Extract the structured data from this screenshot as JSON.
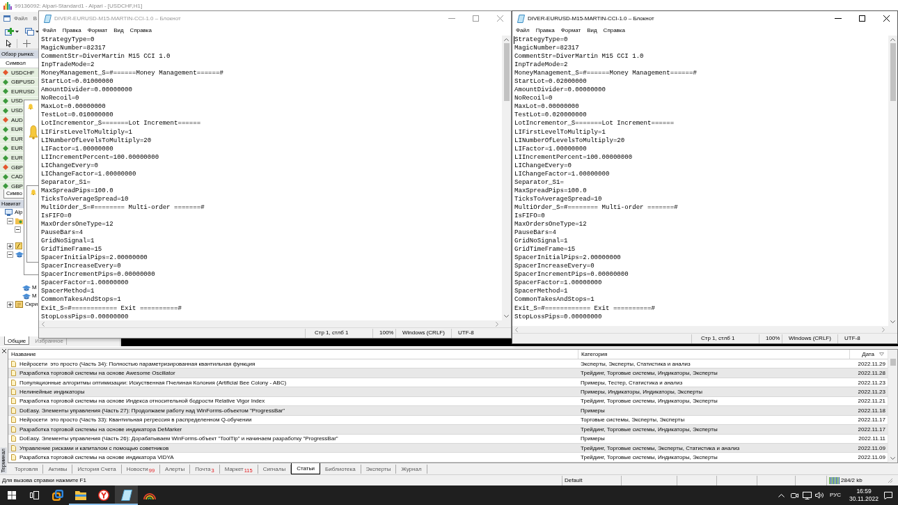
{
  "main_window": {
    "title": "99136092: Alpari-Standard1 - Alpari - [USDCHF,H1]",
    "menu": [
      "Файл",
      "В"
    ]
  },
  "market_watch": {
    "title": "Обзор рынка:",
    "column": "Символ",
    "symbols": [
      {
        "name": "USDCHF",
        "color": "#e4572e"
      },
      {
        "name": "GBPUSD",
        "color": "#3c9a3c"
      },
      {
        "name": "EURUSD",
        "color": "#3c9a3c"
      },
      {
        "name": "USD",
        "color": "#3c9a3c"
      },
      {
        "name": "USD",
        "color": "#3c9a3c"
      },
      {
        "name": "AUD",
        "color": "#e4572e"
      },
      {
        "name": "EUR",
        "color": "#3c9a3c"
      },
      {
        "name": "EUR",
        "color": "#3c9a3c"
      },
      {
        "name": "EUR",
        "color": "#3c9a3c"
      },
      {
        "name": "EUR",
        "color": "#3c9a3c"
      },
      {
        "name": "GBP",
        "color": "#e4572e"
      },
      {
        "name": "CAD",
        "color": "#3c9a3c"
      },
      {
        "name": "GBP",
        "color": "#3c9a3c"
      }
    ],
    "tab": "Симво"
  },
  "navigator": {
    "title": "Навигат",
    "tree": [
      {
        "kind": "terminal",
        "label": "Alp",
        "children": [
          {
            "kind": "accounts",
            "expanded": true,
            "children": [
              {
                "kind": "account",
                "expanded": true
              }
            ]
          },
          {
            "kind": "indicators",
            "expanded": false
          },
          {
            "kind": "experts",
            "expanded": true,
            "children": [
              {
                "kind": "expert",
                "label": "М"
              },
              {
                "kind": "expert",
                "label": "М"
              }
            ]
          },
          {
            "kind": "scripts",
            "expanded": false,
            "label": "Скри"
          }
        ]
      }
    ],
    "tabs": [
      {
        "label": "Общие",
        "selected": true
      },
      {
        "label": "Избранное",
        "selected": false
      }
    ]
  },
  "notepad_windows": [
    {
      "title": "DIVER-EURUSD-M15-MARTIN-CCI-1.0 – Блокнот",
      "active": false,
      "menu": [
        "Файл",
        "Правка",
        "Формат",
        "Вид",
        "Справка"
      ],
      "lines": [
        "StrategyType=0",
        "MagicNumber=82317",
        "CommentStr=DiverMartin M15 CCI 1.0",
        "InpTradeMode=2",
        "MoneyManagement_S=#======Money Management======#",
        "StartLot=0.01000000",
        "AmountDivider=0.00000000",
        "NoRecoil=0",
        "MaxLot=0.00000000",
        "TestLot=0.010000000",
        "LotIncrementor_S=======Lot Increment======",
        "LIFirstLevelToMultiply=1",
        "LINumberOfLevelsToMultiply=20",
        "LIFactor=1.00000000",
        "LIIncrementPercent=100.00000000",
        "LIChangeEvery=0",
        "LIChangeFactor=1.00000000",
        "Separator_S1=",
        "MaxSpreadPips=100.0",
        "TicksToAverageSpread=10",
        "MultiOrder_S=#======== Multi-order =======#",
        "IsFIFO=0",
        "MaxOrdersOneType=12",
        "PauseBars=4",
        "GridNoSignal=1",
        "GridTimeFrame=15",
        "SpacerInitialPips=2.00000000",
        "SpacerIncreaseEvery=0",
        "SpacerIncrementPips=0.00000000",
        "SpacerFactor=1.00000000",
        "SpacerMethod=1",
        "CommonTakesAndStops=1",
        "Exit_S=#============ Exit ==========#",
        "StopLossPips=0.00000000"
      ],
      "status": [
        "Стр 1, стлб 1",
        "100%",
        "Windows (CRLF)",
        "UTF-8"
      ]
    },
    {
      "title": "DIVER-EURUSD-M15-MARTIN-CCI-1.0 – Блокнот",
      "active": true,
      "menu": [
        "Файл",
        "Правка",
        "Формат",
        "Вид",
        "Справка"
      ],
      "lines": [
        "StrategyType=0",
        "MagicNumber=82317",
        "CommentStr=DiverMartin M15 CCI 1.0",
        "InpTradeMode=2",
        "MoneyManagement_S=#======Money Management======#",
        "StartLot=0.02000000",
        "AmountDivider=0.00000000",
        "NoRecoil=0",
        "MaxLot=0.00000000",
        "TestLot=0.020000000",
        "LotIncrementor_S=======Lot Increment======",
        "LIFirstLevelToMultiply=1",
        "LINumberOfLevelsToMultiply=20",
        "LIFactor=1.00000000",
        "LIIncrementPercent=100.00000000",
        "LIChangeEvery=0",
        "LIChangeFactor=1.00000000",
        "Separator_S1=",
        "MaxSpreadPips=100.0",
        "TicksToAverageSpread=10",
        "MultiOrder_S=#======== Multi-order =======#",
        "IsFIFO=0",
        "MaxOrdersOneType=12",
        "PauseBars=4",
        "GridNoSignal=1",
        "GridTimeFrame=15",
        "SpacerInitialPips=2.00000000",
        "SpacerIncreaseEvery=0",
        "SpacerIncrementPips=0.00000000",
        "SpacerFactor=1.00000000",
        "SpacerMethod=1",
        "CommonTakesAndStops=1",
        "Exit_S=#============ Exit ==========#",
        "StopLossPips=0.00000000"
      ],
      "status": [
        "Стр 1, стлб 1",
        "100%",
        "Windows (CRLF)",
        "UTF-8"
      ]
    }
  ],
  "terminal": {
    "side_label": "Терминал",
    "columns": [
      "Название",
      "Категория",
      "Дата"
    ],
    "rows": [
      {
        "title": "Нейросети  это просто (Часть 34): Полностью параметризированная квантильная функция",
        "category": "Эксперты, Эксперты, Статистика и анализ",
        "date": "2022.11.29"
      },
      {
        "title": "Разработка торговой системы на основе Awesome Oscillator",
        "category": "Трейдинг, Торговые системы, Индикаторы, Эксперты",
        "date": "2022.11.28"
      },
      {
        "title": "Популяционные алгоритмы оптимизации: Искуственная Пчелиная Колония (Artificial Bee Colony - ABC)",
        "category": "Примеры, Тестер, Статистика и анализ",
        "date": "2022.11.23"
      },
      {
        "title": "Нелинейные индикаторы",
        "category": "Примеры, Индикаторы, Индикаторы, Эксперты",
        "date": "2022.11.23"
      },
      {
        "title": "Разработка торговой системы на основе Индекса относительной бодрости Relative Vigor Index",
        "category": "Трейдинг, Торговые системы, Индикаторы, Эксперты",
        "date": "2022.11.21"
      },
      {
        "title": "DoEasy. Элементы управления (Часть 27): Продолжаем работу над WinForms-объектом \"ProgressBar\"",
        "category": "Примеры",
        "date": "2022.11.18"
      },
      {
        "title": "Нейросети  это просто (Часть 33): Квантильная регрессия в распределенном Q-обучении",
        "category": "Торговые системы, Эксперты, Эксперты",
        "date": "2022.11.17"
      },
      {
        "title": "Разработка торговой системы на основе индикатора DeMarker",
        "category": "Трейдинг, Торговые системы, Индикаторы, Эксперты",
        "date": "2022.11.17"
      },
      {
        "title": "DoEasy. Элементы управления (Часть 26): Дорабатываем WinForms-объект \"ToolTip\" и начинаем разработку \"ProgressBar\"",
        "category": "Примеры",
        "date": "2022.11.11"
      },
      {
        "title": "Управление рисками и капиталом с помощью советников",
        "category": "Трейдинг, Торговые системы, Эксперты, Статистика и анализ",
        "date": "2022.11.09"
      },
      {
        "title": "Разработка торговой системы на основе индикатора VIDYA",
        "category": "Трейдинг, Торговые системы, Индикаторы, Эксперты",
        "date": "2022.11.09"
      }
    ],
    "tabs": [
      {
        "label": "Торговля",
        "selected": false
      },
      {
        "label": "Активы",
        "selected": false
      },
      {
        "label": "История Счета",
        "selected": false
      },
      {
        "label": "Новости",
        "count": "99",
        "selected": false
      },
      {
        "label": "Алерты",
        "selected": false
      },
      {
        "label": "Почта",
        "count": "3",
        "selected": false
      },
      {
        "label": "Маркет",
        "count": "115",
        "selected": false
      },
      {
        "label": "Сигналы",
        "selected": false
      },
      {
        "label": "Статьи",
        "selected": true
      },
      {
        "label": "Библиотека",
        "selected": false
      },
      {
        "label": "Эксперты",
        "selected": false
      },
      {
        "label": "Журнал",
        "selected": false
      }
    ]
  },
  "status_bar": {
    "hint": "Для вызова справки нажмите F1",
    "profile": "Default",
    "traffic": "284/2 kb"
  },
  "taskbar": {
    "apps": [
      {
        "kind": "start",
        "running": false,
        "active": false
      },
      {
        "kind": "task_view",
        "running": false,
        "active": false
      },
      {
        "kind": "squares",
        "running": false,
        "active": false
      },
      {
        "kind": "folder",
        "running": true,
        "active": false
      },
      {
        "kind": "browser",
        "running": true,
        "active": false
      },
      {
        "kind": "notepad",
        "running": true,
        "active": true
      },
      {
        "kind": "arch",
        "running": false,
        "active": false
      }
    ],
    "language": "РУС",
    "time": "16:59",
    "date": "30.11.2022"
  }
}
